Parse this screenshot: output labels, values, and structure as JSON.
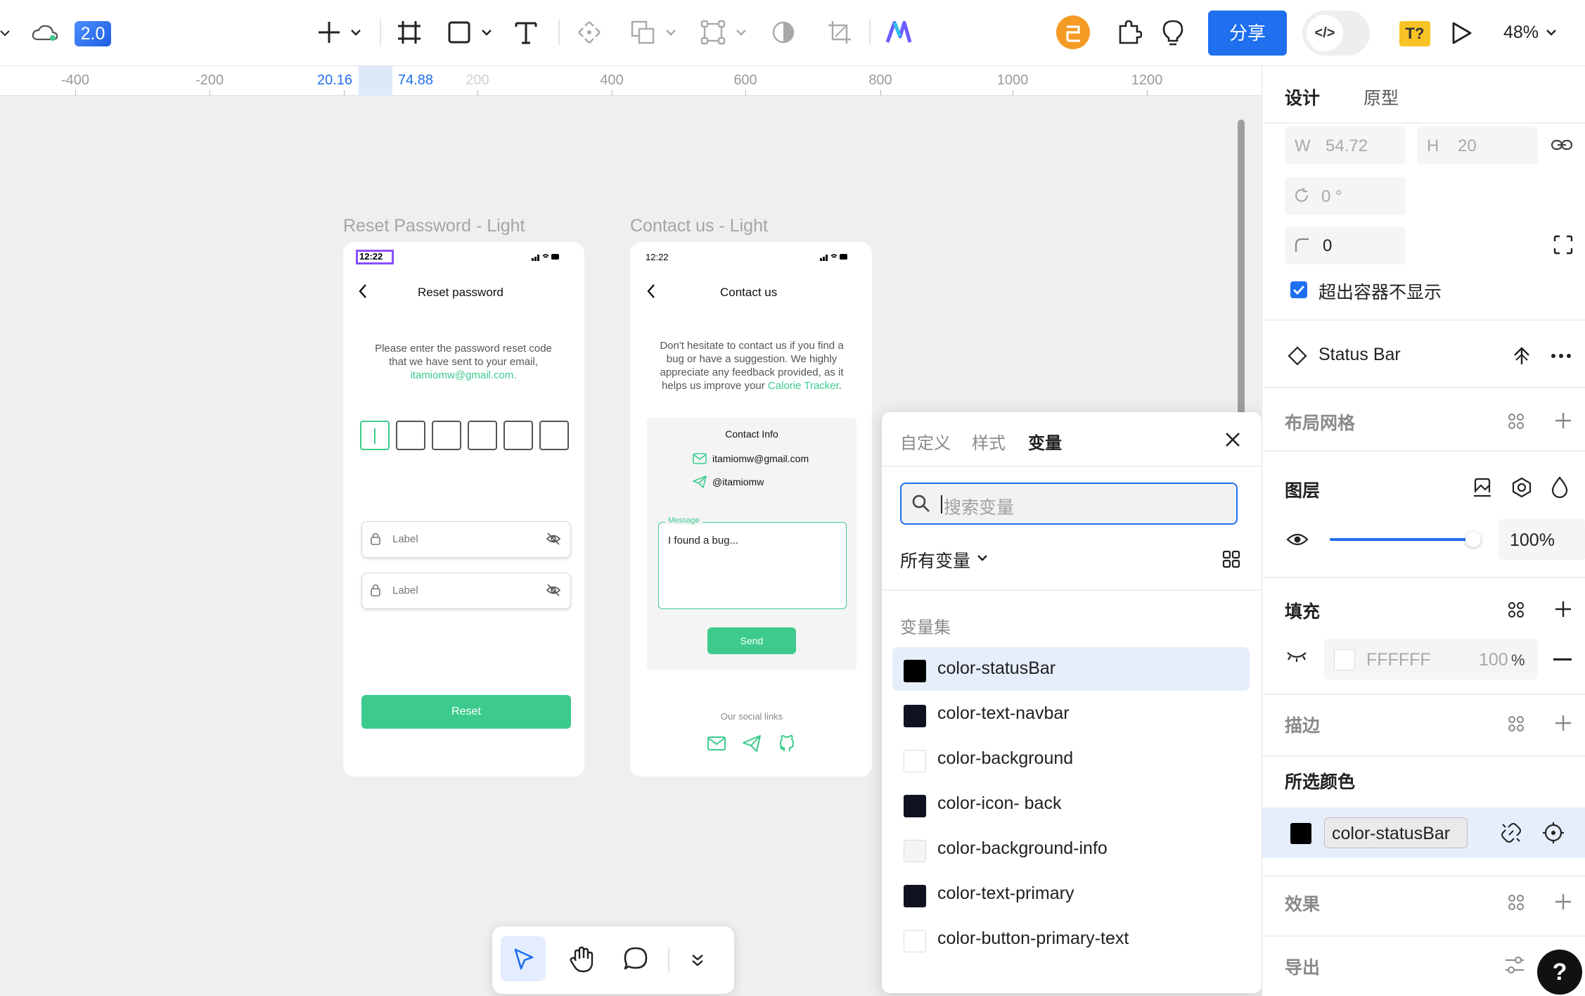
{
  "toolbar": {
    "version_badge": "2.0",
    "share_label": "分享",
    "code_label": "</>",
    "font_missing_label": "T?",
    "zoom": "48%"
  },
  "ruler": {
    "labels": [
      "-400",
      "-200",
      "20.16",
      "74.88",
      "200",
      "400",
      "600",
      "800",
      "1000",
      "1200"
    ]
  },
  "frames": {
    "reset": {
      "title": "Reset Password - Light",
      "time": "12:22",
      "heading": "Reset password",
      "desc_line1": "Please enter the password reset code",
      "desc_line2": "that we have sent to your email,",
      "email_link": "itamiomw@gmail.com.",
      "field1_label": "Label",
      "field2_label": "Label",
      "reset_button": "Reset"
    },
    "contact": {
      "title": "Contact us - Light",
      "time": "12:22",
      "heading": "Contact us",
      "desc_line1": "Don't hesitate to contact us if you find a",
      "desc_line2": "bug or have a suggestion. We highly",
      "desc_line3": "appreciate any feedback provided, as it",
      "desc_line4_prefix": "helps us improve your ",
      "desc_line4_link": "Calorie Tracker",
      "desc_line4_suffix": ".",
      "info_title": "Contact Info",
      "email": "itamiomw@gmail.com",
      "handle": "@itamiomw",
      "message_label": "Message",
      "message_value": "I found a bug...",
      "send_button": "Send",
      "social_label": "Our social links"
    }
  },
  "variables_panel": {
    "tabs": [
      "自定义",
      "样式",
      "变量"
    ],
    "active_tab": "变量",
    "search_placeholder": "搜索变量",
    "filter_label": "所有变量",
    "section_label": "变量集",
    "variables": [
      {
        "name": "color-statusBar",
        "color": "#000000",
        "selected": true
      },
      {
        "name": "color-text-navbar",
        "color": "#0f1220"
      },
      {
        "name": "color-background",
        "color": "#ffffff"
      },
      {
        "name": "color-icon- back",
        "color": "#0f1220"
      },
      {
        "name": "color-background-info",
        "color": "#f4f4f4"
      },
      {
        "name": "color-text-primary",
        "color": "#0f1220"
      },
      {
        "name": "color-button-primary-text",
        "color": "#ffffff"
      }
    ]
  },
  "right_panel": {
    "tabs": [
      "设计",
      "原型"
    ],
    "w_label": "W",
    "w_value": "54.72",
    "h_label": "H",
    "h_value": "20",
    "rotation": "0 °",
    "radius": "0",
    "clip_label": "超出容器不显示",
    "component_name": "Status Bar",
    "layout_grid": "布局网格",
    "layer": "图层",
    "opacity": "100%",
    "opacity_fraction": 0.98,
    "fill": "填充",
    "fill_hex": "FFFFFF",
    "fill_opacity": "100",
    "fill_percent": "%",
    "stroke": "描边",
    "selected_colors": "所选颜色",
    "selected_var": "color-statusBar",
    "effects": "效果",
    "export": "导出"
  },
  "colors": {
    "accent": "#1f6fef",
    "brand_green": "#3ccb8c",
    "selection": "#8a4fff"
  },
  "icons": [
    "cloud-sync-icon",
    "plus-icon",
    "frame-icon",
    "rectangle-icon",
    "text-icon",
    "move-icon",
    "boolean-icon",
    "component-icon",
    "mask-icon",
    "crop-icon",
    "ai-logo-icon",
    "avatar",
    "plugin-icon",
    "bulb-icon",
    "play-icon",
    "search-icon",
    "grid-icon",
    "close-icon",
    "link-icon",
    "eye-icon",
    "hand-icon",
    "comment-icon",
    "cursor-icon",
    "help-icon"
  ]
}
